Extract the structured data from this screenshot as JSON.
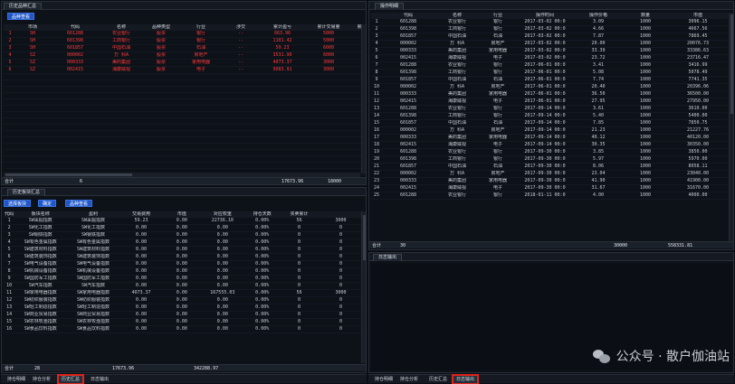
{
  "stock_summary": {
    "tab": "历史品种汇总",
    "button": "品种查看",
    "headers": [
      "",
      "市场",
      "代码",
      "名称",
      "品种类型",
      "行业",
      "涉交",
      "累计盈亏",
      "累计交易量",
      "累"
    ],
    "rows": [
      [
        "1",
        "SH",
        "601288",
        "农业银行",
        "股票",
        "银行",
        "--",
        "663.96",
        "5000",
        ""
      ],
      [
        "2",
        "SH",
        "601398",
        "工商银行",
        "股票",
        "银行",
        "--",
        "1101.42",
        "5000",
        ""
      ],
      [
        "3",
        "SH",
        "601857",
        "中国石油",
        "股票",
        "石油",
        "--",
        "59.23",
        "6000",
        ""
      ],
      [
        "4",
        "SZ",
        "000002",
        "万 科A",
        "股票",
        "房地产",
        "--",
        "3531.90",
        "6000",
        ""
      ],
      [
        "5",
        "SZ",
        "000333",
        "美的集团",
        "股票",
        "家用电器",
        "--",
        "4073.37",
        "3000",
        ""
      ],
      [
        "6",
        "SZ",
        "002415",
        "海康威视",
        "股票",
        "电子",
        "--",
        "9083.91",
        "3000",
        ""
      ]
    ],
    "summary": {
      "label": "合计",
      "count": "6",
      "pnl": "17673.96",
      "volume": "18000"
    }
  },
  "sector_summary": {
    "tab": "历史板块汇总",
    "buttons": [
      "选择板块",
      "确定",
      "品种查看"
    ],
    "headers": [
      "代码",
      "板块名称",
      "盈利",
      "交易费用",
      "市值",
      "对应权重",
      "持仓天数",
      "买卖累计",
      ""
    ],
    "rows": [
      [
        "1",
        "SW采掘指数",
        "SW采掘指数",
        "59.23",
        "0.00",
        "22736.10",
        "0.00%",
        "56",
        "3000"
      ],
      [
        "2",
        "SW化工指数",
        "SW化工指数",
        "0.00",
        "0.00",
        "0.00",
        "0.00%",
        "0",
        "0"
      ],
      [
        "3",
        "SW钢铁指数",
        "SW钢铁指数",
        "0.00",
        "0.00",
        "0.00",
        "0.00%",
        "0",
        "0"
      ],
      [
        "4",
        "SW有色金属指数",
        "SW有色金属指数",
        "0.00",
        "0.00",
        "0.00",
        "0.00%",
        "0",
        "0"
      ],
      [
        "5",
        "SW建筑材料指数",
        "SW建筑材料指数",
        "0.00",
        "0.00",
        "0.00",
        "0.00%",
        "0",
        "0"
      ],
      [
        "6",
        "SW建筑装饰指数",
        "SW建筑装饰指数",
        "0.00",
        "0.00",
        "0.00",
        "0.00%",
        "0",
        "0"
      ],
      [
        "7",
        "SW电气设备指数",
        "SW电气设备指数",
        "0.00",
        "0.00",
        "0.00",
        "0.00%",
        "0",
        "0"
      ],
      [
        "8",
        "SW机械设备指数",
        "SW机械设备指数",
        "0.00",
        "0.00",
        "0.00",
        "0.00%",
        "0",
        "0"
      ],
      [
        "9",
        "SW国防军工指数",
        "SW国防军工指数",
        "0.00",
        "0.00",
        "0.00",
        "0.00%",
        "0",
        "0"
      ],
      [
        "10",
        "SW汽车指数",
        "SW汽车指数",
        "0.00",
        "0.00",
        "0.00",
        "0.00%",
        "0",
        "0"
      ],
      [
        "11",
        "SW家用电器指数",
        "SW家用电器指数",
        "4073.37",
        "0.00",
        "167555.03",
        "0.00%",
        "56",
        "3000"
      ],
      [
        "12",
        "SW纺织服装指数",
        "SW纺织服装指数",
        "0.00",
        "0.00",
        "0.00",
        "0.00%",
        "0",
        "0"
      ],
      [
        "13",
        "SW轻工制造指数",
        "SW轻工制造指数",
        "0.00",
        "0.00",
        "0.00",
        "0.00%",
        "0",
        "0"
      ],
      [
        "14",
        "SW商业贸易指数",
        "SW商业贸易指数",
        "0.00",
        "0.00",
        "0.00",
        "0.00%",
        "0",
        "0"
      ],
      [
        "15",
        "SW农林牧渔指数",
        "SW农林牧渔指数",
        "0.00",
        "0.00",
        "0.00",
        "0.00%",
        "0",
        "0"
      ],
      [
        "16",
        "SW食品饮料指数",
        "SW食品饮料指数",
        "0.00",
        "0.00",
        "0.00",
        "0.00%",
        "0",
        "0"
      ]
    ],
    "summary": {
      "label": "合计",
      "count": "28",
      "pnl": "17673.96",
      "value": "342288.97"
    }
  },
  "trade_details": {
    "tab": "操作明细",
    "headers": [
      "",
      "代码",
      "名称",
      "行业",
      "操作时间",
      "操作价格",
      "数量",
      "市值"
    ],
    "rows": [
      [
        "1",
        "601288",
        "农业银行",
        "银行",
        "2017-03-02 00:0",
        "3.09",
        "1000",
        "3096.15"
      ],
      [
        "2",
        "601398",
        "工商银行",
        "银行",
        "2017-03-02 00:0",
        "4.66",
        "1000",
        "4667.56"
      ],
      [
        "3",
        "601857",
        "中国石油",
        "石油",
        "2017-03-02 00:0",
        "7.87",
        "1000",
        "7869.45"
      ],
      [
        "4",
        "000002",
        "万 科A",
        "房地产",
        "2017-03-02 00:0",
        "20.00",
        "1000",
        "20076.73"
      ],
      [
        "5",
        "000333",
        "美的集团",
        "家用电器",
        "2017-03-02 00:0",
        "33.39",
        "1000",
        "33386.63"
      ],
      [
        "6",
        "002415",
        "海康威视",
        "电子",
        "2017-03-02 00:0",
        "23.72",
        "1000",
        "23716.47"
      ],
      [
        "7",
        "601288",
        "农业银行",
        "银行",
        "2017-06-01 00:0",
        "3.41",
        "1000",
        "3416.99"
      ],
      [
        "8",
        "601398",
        "工商银行",
        "银行",
        "2017-06-01 00:0",
        "5.08",
        "1000",
        "5078.49"
      ],
      [
        "9",
        "601857",
        "中国石油",
        "石油",
        "2017-06-01 00:0",
        "7.74",
        "1000",
        "7741.35"
      ],
      [
        "10",
        "000002",
        "万 科A",
        "房地产",
        "2017-06-01 00:0",
        "20.40",
        "1000",
        "20396.06"
      ],
      [
        "11",
        "000333",
        "美的集团",
        "家用电器",
        "2017-06-01 00:0",
        "36.50",
        "1000",
        "36500.00"
      ],
      [
        "12",
        "002415",
        "海康威视",
        "电子",
        "2017-06-01 00:0",
        "27.95",
        "1000",
        "27950.00"
      ],
      [
        "13",
        "601288",
        "农业银行",
        "银行",
        "2017-09-14 00:0",
        "3.61",
        "1000",
        "3610.00"
      ],
      [
        "14",
        "601398",
        "工商银行",
        "银行",
        "2017-09-14 00:0",
        "5.40",
        "1000",
        "5400.00"
      ],
      [
        "15",
        "601857",
        "中国石油",
        "石油",
        "2017-09-14 00:0",
        "7.85",
        "1000",
        "7850.75"
      ],
      [
        "16",
        "000002",
        "万 科A",
        "房地产",
        "2017-09-14 00:0",
        "21.23",
        "1000",
        "21227.76"
      ],
      [
        "17",
        "000333",
        "美的集团",
        "家用电器",
        "2017-09-14 00:0",
        "40.12",
        "1000",
        "40120.00"
      ],
      [
        "18",
        "002415",
        "海康威视",
        "电子",
        "2017-09-14 00:0",
        "30.35",
        "1000",
        "30350.00"
      ],
      [
        "19",
        "601288",
        "农业银行",
        "银行",
        "2017-09-30 00:0",
        "3.85",
        "1000",
        "3850.00"
      ],
      [
        "20",
        "601398",
        "工商银行",
        "银行",
        "2017-09-30 00:0",
        "5.97",
        "1000",
        "5970.00"
      ],
      [
        "21",
        "601857",
        "中国石油",
        "石油",
        "2017-09-30 00:0",
        "8.06",
        "1000",
        "8058.11"
      ],
      [
        "22",
        "000002",
        "万 科A",
        "房地产",
        "2017-09-30 00:0",
        "23.04",
        "1000",
        "23040.00"
      ],
      [
        "23",
        "000333",
        "美的集团",
        "家用电器",
        "2017-09-30 00:0",
        "41.90",
        "1000",
        "41900.00"
      ],
      [
        "24",
        "002415",
        "海康威视",
        "电子",
        "2017-09-30 00:0",
        "31.67",
        "1000",
        "31670.00"
      ],
      [
        "25",
        "601288",
        "农业银行",
        "银行",
        "2018-01-11 00:0",
        "4.00",
        "1000",
        "4000.00"
      ]
    ],
    "summary": {
      "label": "合计",
      "count": "30",
      "qty": "30000",
      "value": "558331.81"
    }
  },
  "log_panel": {
    "tab": "日志输出"
  },
  "bottom_left_tabs": [
    "持仓明细",
    "持仓分析",
    "历史汇总",
    "日志输出"
  ],
  "bottom_right_tabs": [
    "持仓明细",
    "持仓分析",
    "历史汇总",
    "日志输出"
  ],
  "watermark": {
    "text": "公众号 · 散户伽油站"
  },
  "colors": {
    "accent_blue": "#1f56c9",
    "profit_red": "#ff3b3b",
    "highlight": "#e0241d"
  }
}
